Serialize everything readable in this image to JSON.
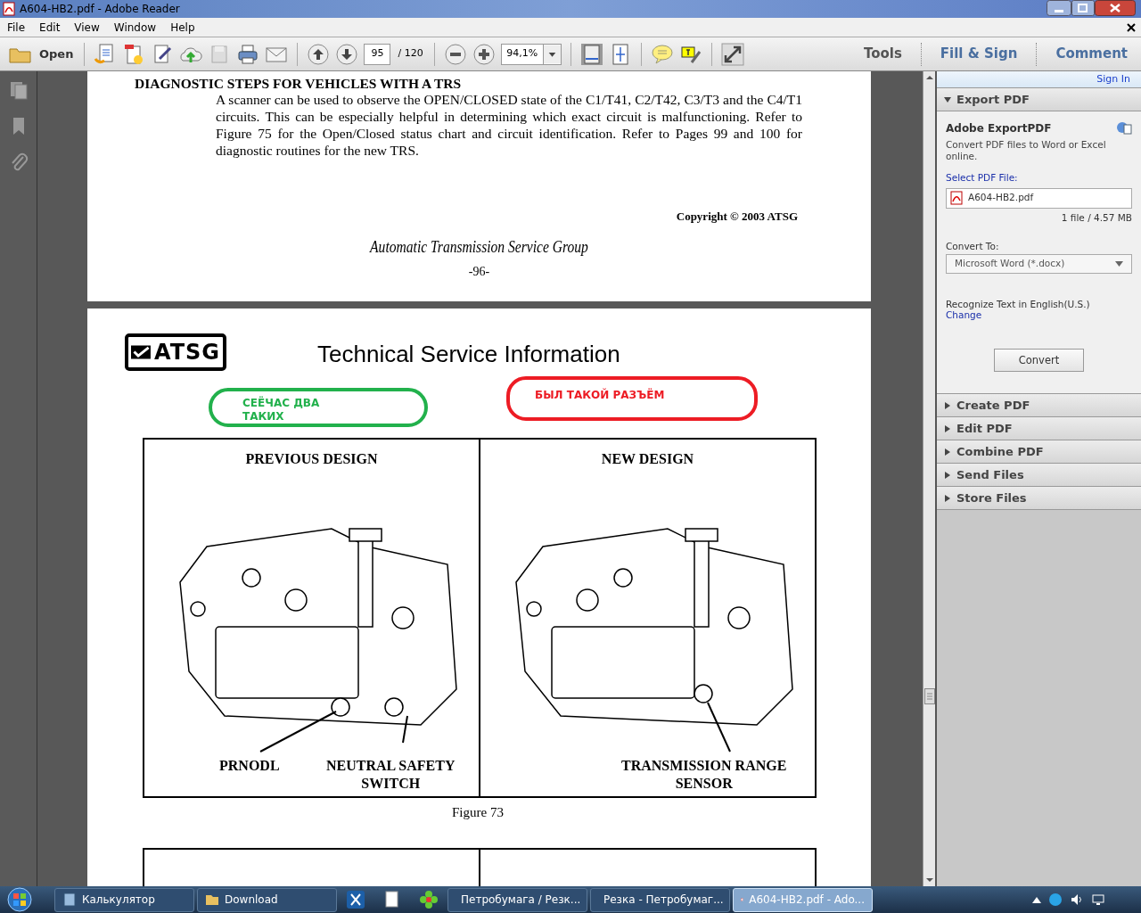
{
  "window": {
    "title": "A604-HB2.pdf - Adobe Reader"
  },
  "menu": [
    "File",
    "Edit",
    "View",
    "Window",
    "Help"
  ],
  "toolbar": {
    "open": "Open",
    "page": "95",
    "page_total": "/ 120",
    "zoom": "94,1%",
    "tabs": [
      {
        "label": "Tools",
        "selected": false
      },
      {
        "label": "Fill & Sign",
        "selected": false
      },
      {
        "label": "Comment",
        "selected": false
      }
    ]
  },
  "document": {
    "page1": {
      "heading": "DIAGNOSTIC STEPS FOR VEHICLES WITH A TRS",
      "paragraph": "A scanner can be used to observe the OPEN/CLOSED state of  the C1/T41, C2/T42, C3/T3 and the C4/T1 circuits. This can be especially helpful in determining which exact circuit is malfunctioning. Refer to Figure 75 for the  Open/Closed status chart and circuit identification. Refer to Pages 99 and 100 for diagnostic routines for the new TRS.",
      "copyright": "Copyright © 2003 ATSG",
      "footer": "Automatic Transmission Service Group",
      "page_number": "-96-"
    },
    "page2": {
      "logo": "ATSG",
      "title": "Technical Service Information",
      "callouts": [
        {
          "text": "СЕЁЧАС ДВА\nТАКИХ",
          "color": "#22b14c"
        },
        {
          "text": "БЫЛ ТАКОЙ РАЗЪЁМ",
          "color": "#ed1c24"
        }
      ],
      "figure": {
        "panels": [
          {
            "heading": "PREVIOUS DESIGN",
            "labels": [
              "PRNODL",
              "NEUTRAL SAFETY\nSWITCH"
            ]
          },
          {
            "heading": "NEW DESIGN",
            "labels": [
              "TRANSMISSION RANGE\nSENSOR"
            ]
          }
        ],
        "caption": "Figure 73"
      }
    }
  },
  "panel": {
    "sign_in": "Sign In",
    "sections": [
      {
        "label": "Export PDF",
        "expanded": true
      },
      {
        "label": "Create PDF",
        "expanded": false
      },
      {
        "label": "Edit PDF",
        "expanded": false
      },
      {
        "label": "Combine PDF",
        "expanded": false
      },
      {
        "label": "Send Files",
        "expanded": false
      },
      {
        "label": "Store Files",
        "expanded": false
      }
    ],
    "export": {
      "title": "Adobe ExportPDF",
      "description": "Convert PDF files to Word or Excel online.",
      "select_label": "Select PDF File:",
      "file": "A604-HB2.pdf",
      "file_info": "1 file / 4.57 MB",
      "convert_to_label": "Convert To:",
      "convert_to": "Microsoft Word (*.docx)",
      "recognize": "Recognize Text in English(U.S.)",
      "change": "Change",
      "button": "Convert"
    }
  },
  "taskbar": [
    {
      "label": "Калькулятор",
      "selected": false
    },
    {
      "label": "Download",
      "selected": false
    },
    {
      "label": "Петробумага / Резк...",
      "selected": false
    },
    {
      "label": "Резка - Петробумаг...",
      "selected": false
    },
    {
      "label": "A604-HB2.pdf - Ado...",
      "selected": true
    }
  ]
}
